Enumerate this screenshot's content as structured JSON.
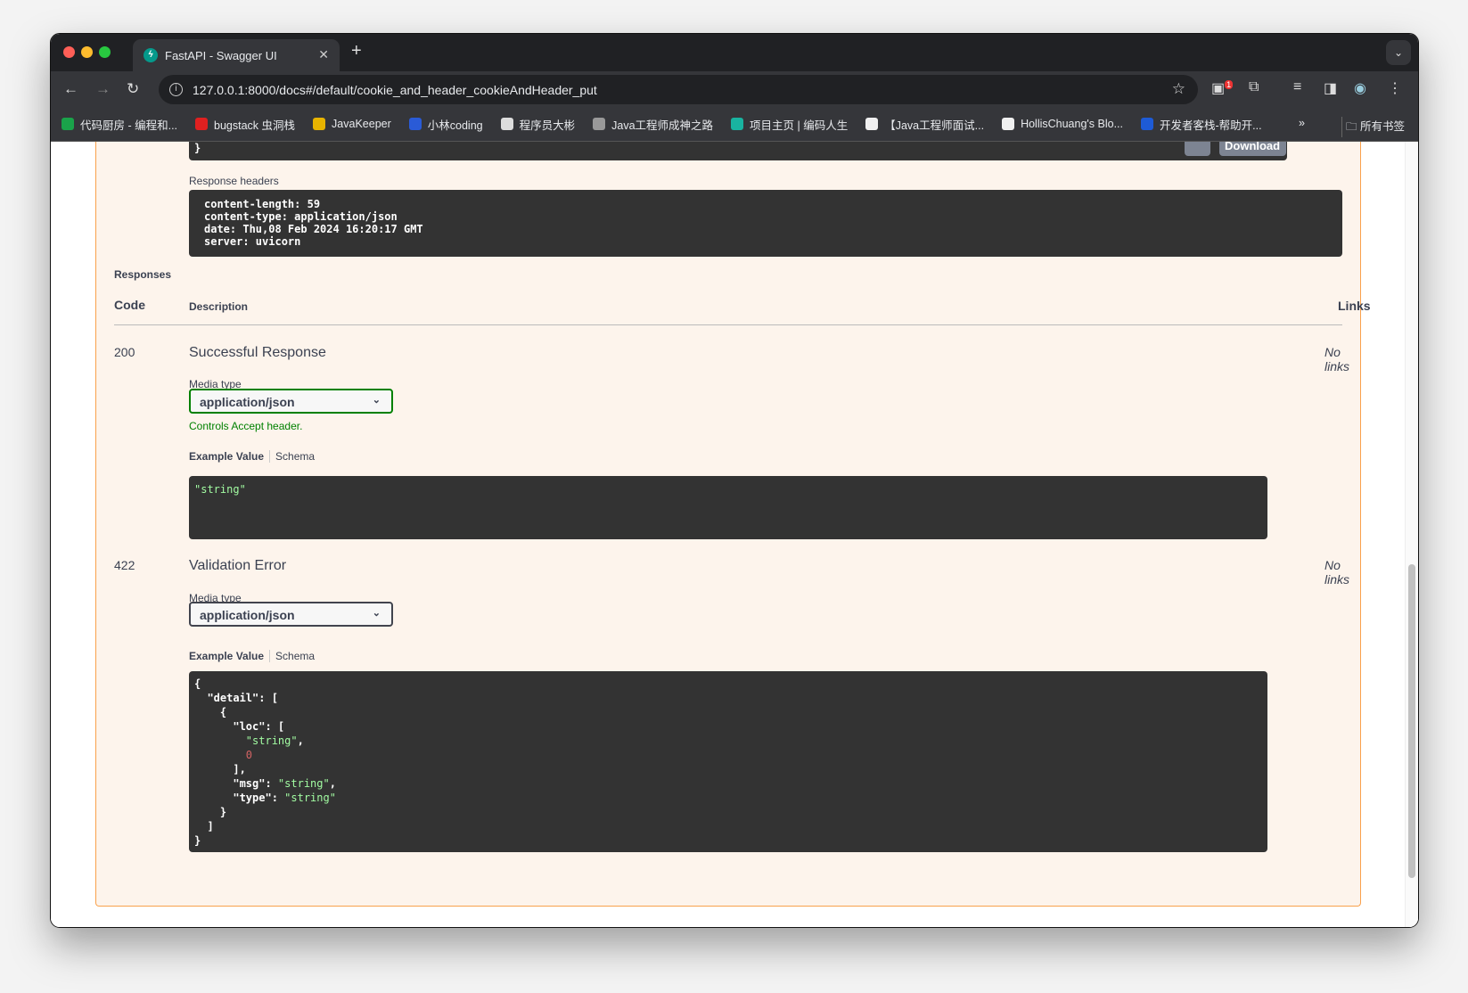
{
  "browser": {
    "tab_title": "FastAPI - Swagger UI",
    "url": "127.0.0.1:8000/docs#/default/cookie_and_header_cookieAndHeader_put",
    "extension_badge": "1",
    "bookmarks": [
      {
        "label": "代码厨房 - 编程和...",
        "color": "#1aa34a"
      },
      {
        "label": "bugstack 虫洞栈",
        "color": "#e02020"
      },
      {
        "label": "JavaKeeper",
        "color": "#e8b400"
      },
      {
        "label": "小林coding",
        "color": "#2a5bd7"
      },
      {
        "label": "程序员大彬",
        "color": "#ddd"
      },
      {
        "label": "Java工程师成神之路",
        "color": "#999"
      },
      {
        "label": "项目主页 | 编码人生",
        "color": "#19b3a0"
      },
      {
        "label": "【Java工程师面试...",
        "color": "#f0f0f0"
      },
      {
        "label": "HollisChuang's Blo...",
        "color": "#f0f0f0"
      },
      {
        "label": "开发者客栈-帮助开...",
        "color": "#1e5bd6"
      }
    ],
    "more_bookmarks": "»",
    "all_bookmarks": "所有书签"
  },
  "page": {
    "top_code_tail": "}",
    "download_label": "Download",
    "response_headers_label": "Response headers",
    "response_headers": "content-length: 59\ncontent-type: application/json\ndate: Thu,08 Feb 2024 16:20:17 GMT\nserver: uvicorn",
    "responses_label": "Responses",
    "columns": {
      "code": "Code",
      "description": "Description",
      "links": "Links"
    },
    "responses": [
      {
        "code": "200",
        "description": "Successful Response",
        "media_type_label": "Media type",
        "media_type": "application/json",
        "controls_note": "Controls Accept header.",
        "example_tab": "Example Value",
        "schema_tab": "Schema",
        "links": "No links"
      },
      {
        "code": "422",
        "description": "Validation Error",
        "media_type_label": "Media type",
        "media_type": "application/json",
        "example_tab": "Example Value",
        "schema_tab": "Schema",
        "links": "No links"
      }
    ]
  }
}
